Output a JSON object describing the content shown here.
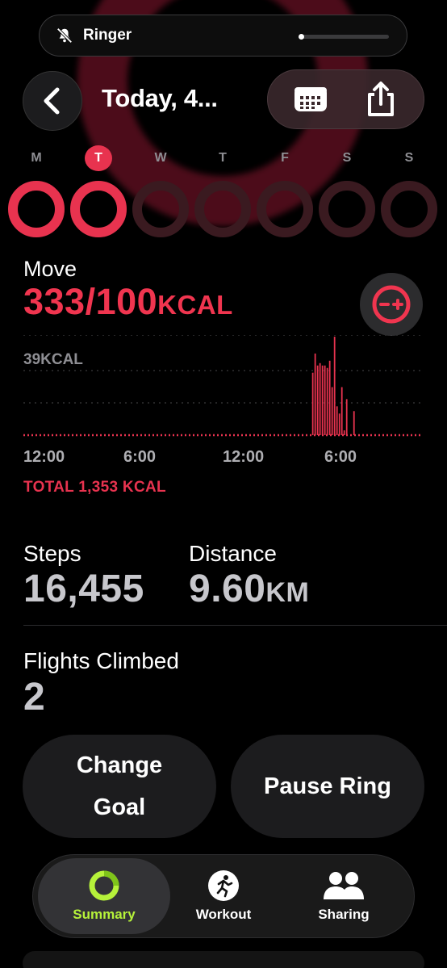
{
  "status": {
    "ringer_label": "Ringer",
    "ringer_level": 0.02
  },
  "header": {
    "title": "Today, 4...",
    "icons": [
      "chevron-left-icon",
      "calendar-icon",
      "share-icon"
    ]
  },
  "week": {
    "days": [
      {
        "letter": "M",
        "active": true,
        "today": false
      },
      {
        "letter": "T",
        "active": true,
        "today": true
      },
      {
        "letter": "W",
        "active": false,
        "today": false
      },
      {
        "letter": "T",
        "active": false,
        "today": false
      },
      {
        "letter": "F",
        "active": false,
        "today": false
      },
      {
        "letter": "S",
        "active": false,
        "today": false
      },
      {
        "letter": "S",
        "active": false,
        "today": false
      }
    ]
  },
  "move": {
    "label": "Move",
    "value": "333/100",
    "unit": "KCAL",
    "total": "TOTAL 1,353 KCAL",
    "color": "#f0354f"
  },
  "chart_data": {
    "type": "bar",
    "ylabel": "39KCAL",
    "ylim": [
      0,
      39
    ],
    "x_ticks": [
      "12:00",
      "6:00",
      "12:00",
      "6:00"
    ],
    "series_color": "#e8334f",
    "values": [
      0.2,
      0.2,
      0.2,
      0.2,
      0.2,
      0.2,
      0.2,
      0.2,
      0.2,
      0.2,
      0.2,
      0.2,
      0.2,
      0.2,
      0.2,
      0.2,
      0.2,
      0.2,
      0.2,
      0.2,
      0.2,
      0.2,
      0.2,
      0.2,
      0.2,
      0.2,
      0.2,
      0.2,
      0.2,
      0.2,
      0.2,
      0.2,
      0.2,
      0.2,
      0.2,
      0.2,
      0.2,
      0.2,
      0.2,
      0.2,
      0.2,
      0.2,
      0.2,
      0.2,
      0.2,
      0.2,
      0.2,
      0.2,
      0.2,
      0.2,
      0.2,
      0.2,
      0.2,
      0.2,
      0.2,
      0.2,
      0.2,
      0.2,
      0.2,
      0.2,
      0.2,
      0.2,
      0.2,
      0.2,
      0.2,
      0.2,
      0.2,
      0.2,
      0.2,
      0.2,
      0.2,
      0.2,
      0.2,
      0.2,
      0.2,
      0.2,
      0.2,
      0.2,
      0.2,
      0.2,
      0.2,
      0.2,
      0.2,
      0.2,
      0.2,
      0.2,
      0.2,
      0.2,
      0.2,
      0.5,
      0.2,
      0.2,
      0.2,
      0.2,
      0.2,
      0.2,
      0.2,
      0.2,
      0.2,
      0.2,
      0.2,
      0.2,
      0.2,
      0.2,
      0.2,
      0.2,
      0.2,
      0.2,
      0.2,
      0.2,
      0.2,
      0.2,
      0.2,
      0.2,
      0.2,
      0.2,
      0.2,
      0.2,
      0.2,
      26,
      34,
      29,
      30,
      29,
      29,
      28,
      31,
      20,
      41,
      12,
      9,
      20,
      2,
      15,
      0.2,
      0.2,
      10,
      0.2,
      0.2,
      0.2,
      0.2,
      0.2,
      0.2,
      0.2,
      0.2,
      0.2,
      0.2,
      0.2,
      0.2,
      0.2,
      0.2,
      0.2,
      0.2,
      0.2,
      0.2,
      0.2,
      0.2,
      0.2,
      0.2,
      0.2,
      0.2,
      0.2,
      0.2,
      0.2
    ]
  },
  "stats": {
    "steps_label": "Steps",
    "steps_value": "16,455",
    "distance_label": "Distance",
    "distance_value": "9.60",
    "distance_unit": "KM",
    "flights_label": "Flights Climbed",
    "flights_value": "2"
  },
  "actions": {
    "change_goal_line1": "Change",
    "change_goal_line2": "Goal",
    "pause_ring": "Pause Ring"
  },
  "tabbar": {
    "tabs": [
      {
        "label": "Summary",
        "icon": "activity-ring-icon",
        "active": true,
        "color": "#b6f23a"
      },
      {
        "label": "Workout",
        "icon": "running-figure-icon",
        "active": false,
        "color": "#ffffff"
      },
      {
        "label": "Sharing",
        "icon": "people-icon",
        "active": false,
        "color": "#ffffff"
      }
    ]
  }
}
